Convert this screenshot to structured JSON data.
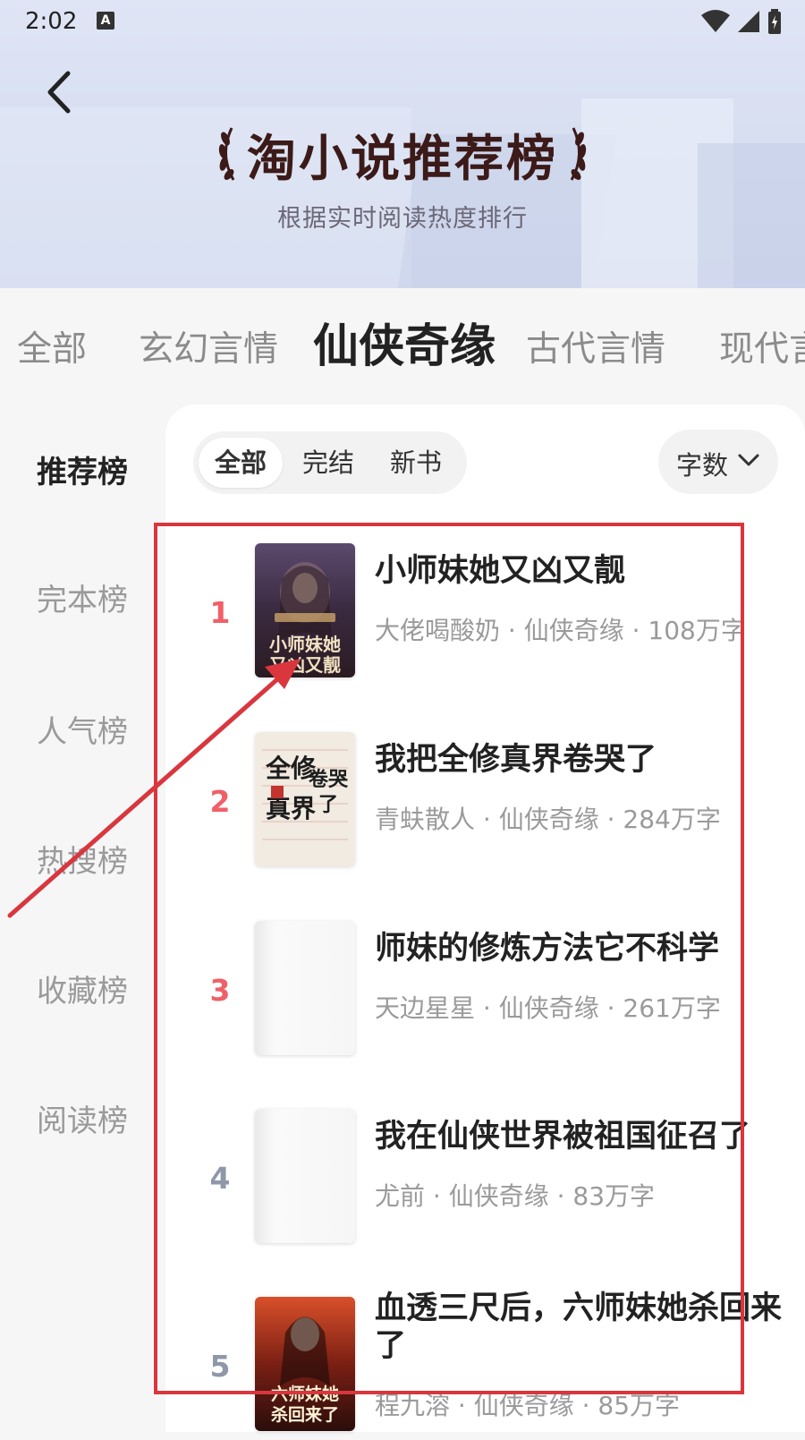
{
  "status_bar": {
    "time": "2:02",
    "notification_letter": "A"
  },
  "header": {
    "title": "淘小说推荐榜",
    "subtitle": "根据实时阅读热度排行"
  },
  "category_tabs": [
    {
      "label": "全部",
      "active": false
    },
    {
      "label": "玄幻言情",
      "active": false
    },
    {
      "label": "仙侠奇缘",
      "active": true
    },
    {
      "label": "古代言情",
      "active": false
    },
    {
      "label": "现代言",
      "active": false
    }
  ],
  "side_nav": [
    {
      "label": "推荐榜",
      "active": true
    },
    {
      "label": "完本榜",
      "active": false
    },
    {
      "label": "人气榜",
      "active": false
    },
    {
      "label": "热搜榜",
      "active": false
    },
    {
      "label": "收藏榜",
      "active": false
    },
    {
      "label": "阅读榜",
      "active": false
    }
  ],
  "filters": [
    {
      "label": "全部",
      "active": true
    },
    {
      "label": "完结",
      "active": false
    },
    {
      "label": "新书",
      "active": false
    }
  ],
  "sort": {
    "label": "字数"
  },
  "books": [
    {
      "rank": "1",
      "title": "小师妹她又凶又靓",
      "meta": "大佬喝酸奶 · 仙侠奇缘 · 108万字",
      "rank_color": "#f06068",
      "cover_text": "小师妹她又凶又靓"
    },
    {
      "rank": "2",
      "title": "我把全修真界卷哭了",
      "meta": "青蚨散人 · 仙侠奇缘 · 284万字",
      "rank_color": "#f06068",
      "cover_text": "全修真界卷哭了"
    },
    {
      "rank": "3",
      "title": "师妹的修炼方法它不科学",
      "meta": "天边星星 · 仙侠奇缘 · 261万字",
      "rank_color": "#f06068",
      "cover_text": ""
    },
    {
      "rank": "4",
      "title": "我在仙侠世界被祖国征召了",
      "meta": "尤前 · 仙侠奇缘 · 83万字",
      "rank_color": "#8f97a8",
      "cover_text": ""
    },
    {
      "rank": "5",
      "title": "血透三尺后，六师妹她杀回来了",
      "meta": "程九溶 · 仙侠奇缘 · 85万字",
      "rank_color": "#8f97a8",
      "cover_text": "六师妹她杀回来了"
    }
  ],
  "colors": {
    "annotation_red": "#d9363e",
    "rank_hot": "#f06068",
    "rank_normal": "#8f97a8"
  }
}
